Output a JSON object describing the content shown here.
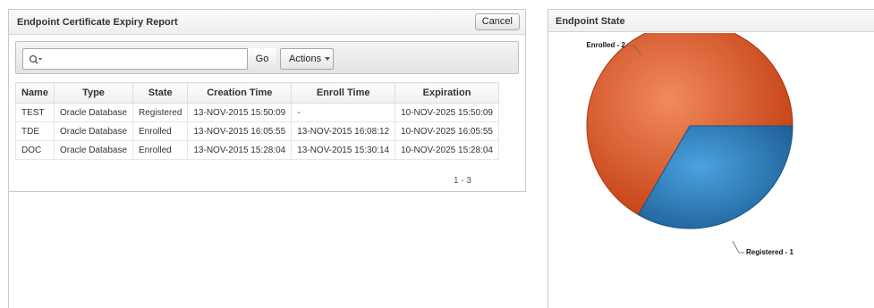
{
  "report": {
    "title": "Endpoint Certificate Expiry Report",
    "cancel_label": "Cancel",
    "search": {
      "placeholder": "",
      "value": ""
    },
    "go_label": "Go",
    "actions_label": "Actions",
    "columns": [
      "Name",
      "Type",
      "State",
      "Creation Time",
      "Enroll Time",
      "Expiration"
    ],
    "rows": [
      [
        "TEST",
        "Oracle Database",
        "Registered",
        "13-NOV-2015 15:50:09",
        "-",
        "10-NOV-2025 15:50:09"
      ],
      [
        "TDE",
        "Oracle Database",
        "Enrolled",
        "13-NOV-2015 16:05:55",
        "13-NOV-2015 16:08:12",
        "10-NOV-2025 16:05:55"
      ],
      [
        "DOC",
        "Oracle Database",
        "Enrolled",
        "13-NOV-2015 15:28:04",
        "13-NOV-2015 15:30:14",
        "10-NOV-2025 15:28:04"
      ]
    ],
    "pagination": "1 - 3"
  },
  "state_panel": {
    "title": "Endpoint State"
  },
  "chart_data": {
    "type": "pie",
    "title": "",
    "slices": [
      {
        "label": "Enrolled - 2",
        "value": 2,
        "color": "#d44a1c"
      },
      {
        "label": "Registered - 1",
        "value": 1,
        "color": "#2f7fbf"
      }
    ]
  },
  "icons": {
    "search": "search-icon",
    "caret": "chevron-down-icon"
  }
}
